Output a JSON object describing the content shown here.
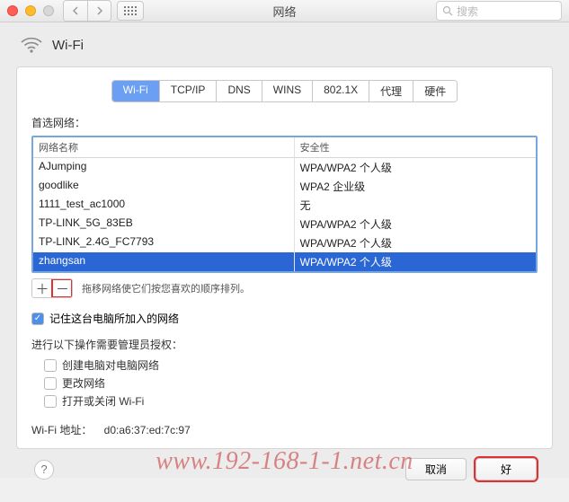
{
  "window": {
    "title": "网络",
    "search_placeholder": "搜索"
  },
  "header": {
    "label": "Wi-Fi"
  },
  "tabs": [
    "Wi-Fi",
    "TCP/IP",
    "DNS",
    "WINS",
    "802.1X",
    "代理",
    "硬件"
  ],
  "active_tab_index": 0,
  "preferred_label": "首选网络：",
  "columns": {
    "name": "网络名称",
    "security": "安全性"
  },
  "networks": [
    {
      "name": "AJumping",
      "security": "WPA/WPA2 个人级"
    },
    {
      "name": "goodlike",
      "security": "WPA2 企业级"
    },
    {
      "name": "1111_test_ac1000",
      "security": "无"
    },
    {
      "name": "TP-LINK_5G_83EB",
      "security": "WPA/WPA2 个人级"
    },
    {
      "name": "TP-LINK_2.4G_FC7793",
      "security": "WPA/WPA2 个人级"
    },
    {
      "name": "zhangsan",
      "security": "WPA/WPA2 个人级"
    }
  ],
  "selected_index": 5,
  "drag_hint": "拖移网络使它们按您喜欢的顺序排列。",
  "remember_label": "记住这台电脑所加入的网络",
  "remember_checked": true,
  "admin_label": "进行以下操作需要管理员授权：",
  "admin_options": [
    {
      "label": "创建电脑对电脑网络",
      "checked": false
    },
    {
      "label": "更改网络",
      "checked": false
    },
    {
      "label": "打开或关闭 Wi-Fi",
      "checked": false
    }
  ],
  "mac": {
    "label": "Wi-Fi 地址：",
    "value": "d0:a6:37:ed:7c:97"
  },
  "buttons": {
    "cancel": "取消",
    "ok": "好"
  },
  "watermark": "www.192-168-1-1.net.cn"
}
